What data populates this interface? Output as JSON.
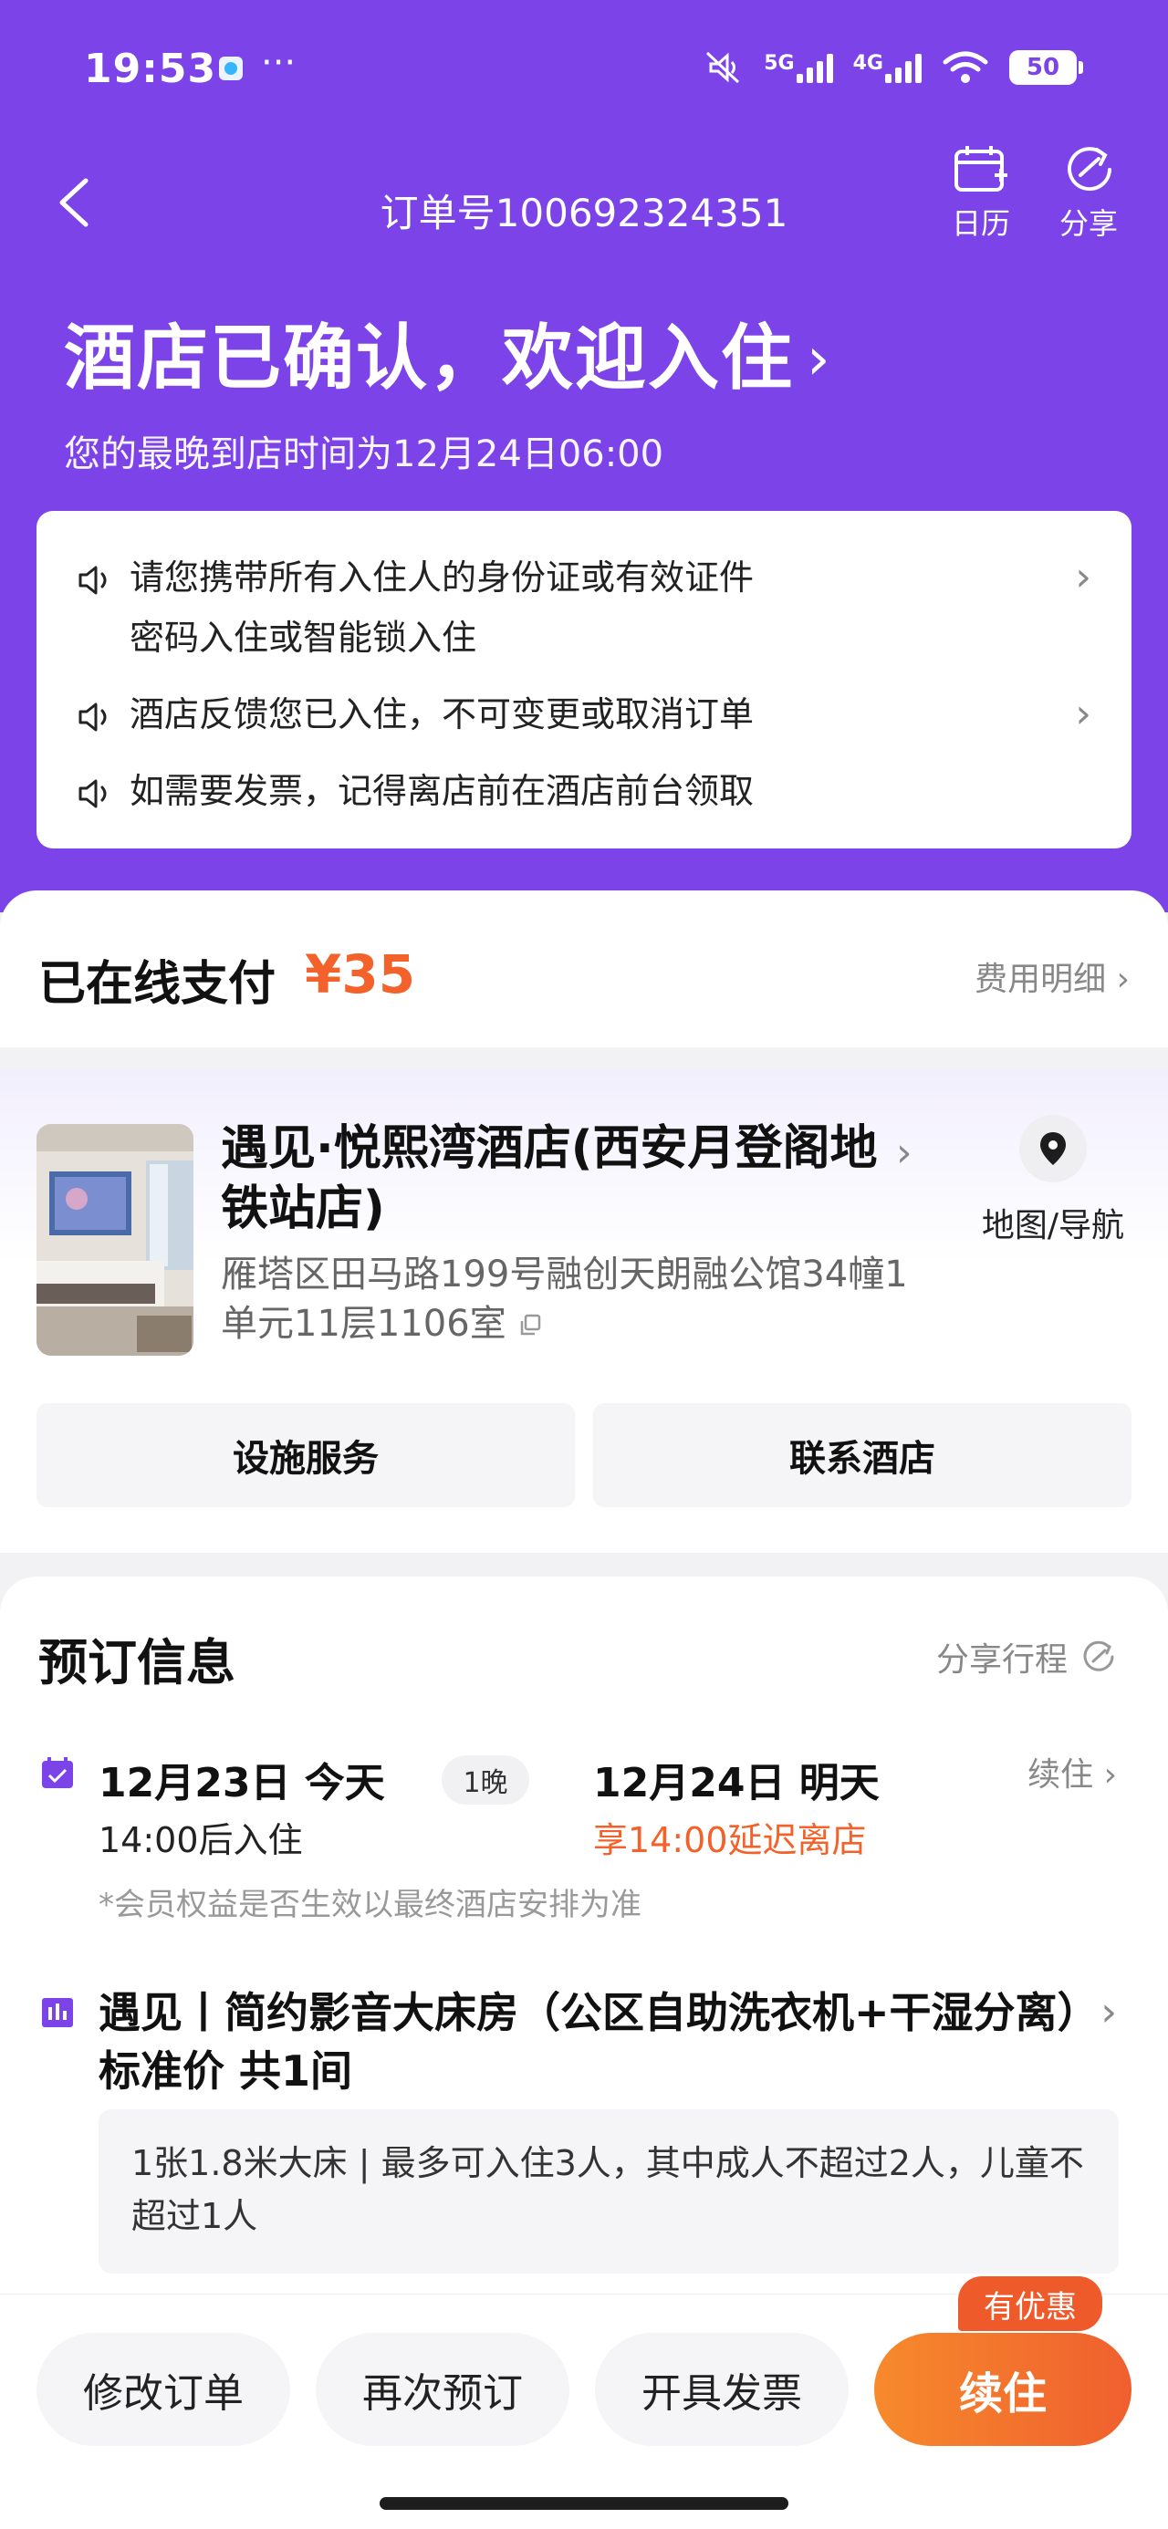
{
  "status_bar": {
    "time": "19:53",
    "more": "···",
    "net1": "5G",
    "net2": "4G",
    "battery": "50"
  },
  "header": {
    "back_label": "返回",
    "order_no": "订单号100692324351",
    "calendar_label": "日历",
    "share_label": "分享",
    "title": "酒店已确认，欢迎入住",
    "subtitle": "您的最晚到店时间为12月24日06:00"
  },
  "notices": [
    {
      "line1": "请您携带所有入住人的身份证或有效证件",
      "line2": "密码入住或智能锁入住"
    },
    {
      "line1": "酒店反馈您已入住，不可变更或取消订单"
    },
    {
      "line1": "如需要发票，记得离店前在酒店前台领取"
    }
  ],
  "payment": {
    "label": "已在线支付",
    "amount": "¥35",
    "detail_link": "费用明细"
  },
  "hotel": {
    "name": "遇见·悦熙湾酒店(西安月登阁地铁站店)",
    "address": "雁塔区田马路199号融创天朗融公馆34幢1单元11层1106室",
    "map_label": "地图/导航",
    "btn_facilities": "设施服务",
    "btn_contact": "联系酒店"
  },
  "booking": {
    "title": "预订信息",
    "share_trip": "分享行程",
    "checkin_date": "12月23日 今天",
    "checkin_note": "14:00后入住",
    "nights": "1晚",
    "checkout_date": "12月24日 明天",
    "checkout_note": "享14:00延迟离店",
    "renew": "续住",
    "member_note": "*会员权益是否生效以最终酒店安排为准",
    "room_name": "遇见丨简约影音大床房（公区自助洗衣机+干湿分离）标准价 共1间",
    "room_detail": "1张1.8米大床 | 最多可入住3人，其中成人不超过2人，儿童不超过1人"
  },
  "bottom_bar": {
    "modify": "修改订单",
    "rebook": "再次预订",
    "invoice": "开具发票",
    "extend": "续住",
    "promo": "有优惠"
  },
  "colors": {
    "brand_purple": "#7b43e8",
    "accent_orange": "#f2622a"
  }
}
